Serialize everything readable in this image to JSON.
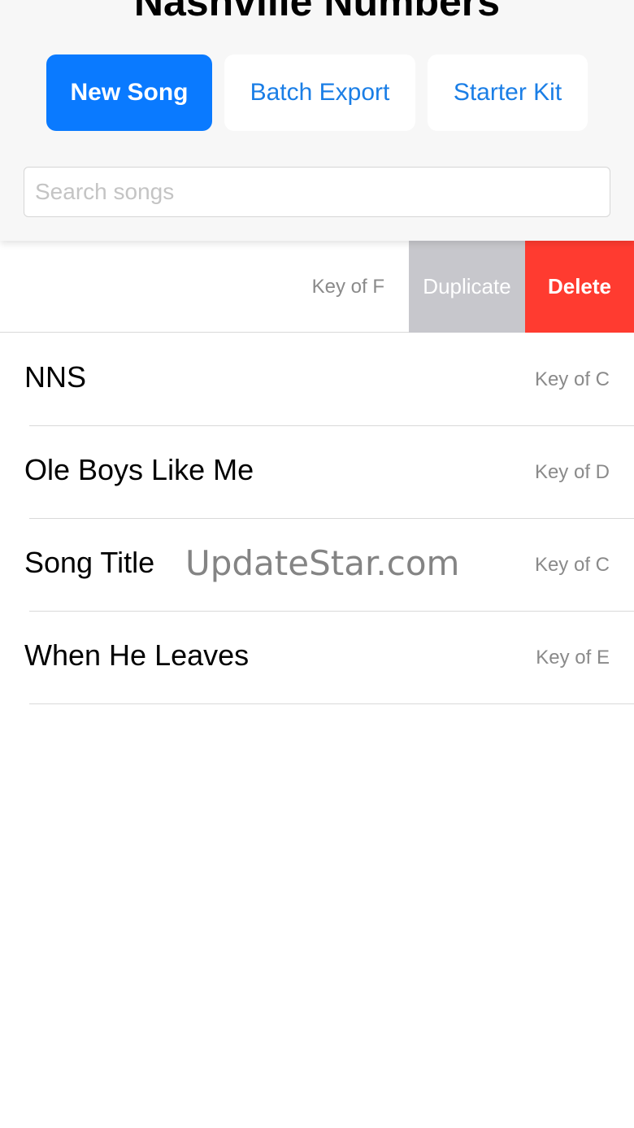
{
  "header": {
    "title": "Nashville Numbers",
    "buttons": {
      "new_song": "New Song",
      "batch_export": "Batch Export",
      "starter_kit": "Starter Kit"
    },
    "search": {
      "placeholder": "Search songs",
      "value": ""
    }
  },
  "swiped_row": {
    "key": "Key of F",
    "actions": {
      "duplicate": "Duplicate",
      "delete": "Delete"
    },
    "colors": {
      "duplicate_bg": "#c7c7cc",
      "delete_bg": "#ff3b30"
    }
  },
  "songs": [
    {
      "title": "NNS",
      "key": "Key of C"
    },
    {
      "title": "Ole Boys Like Me",
      "key": "Key of D"
    },
    {
      "title": "Song Title",
      "key": "Key of C"
    },
    {
      "title": "When He Leaves",
      "key": "Key of E"
    }
  ],
  "watermark": "UpdateStar.com",
  "colors": {
    "accent": "#0a7aff",
    "link": "#1a7ee6"
  }
}
